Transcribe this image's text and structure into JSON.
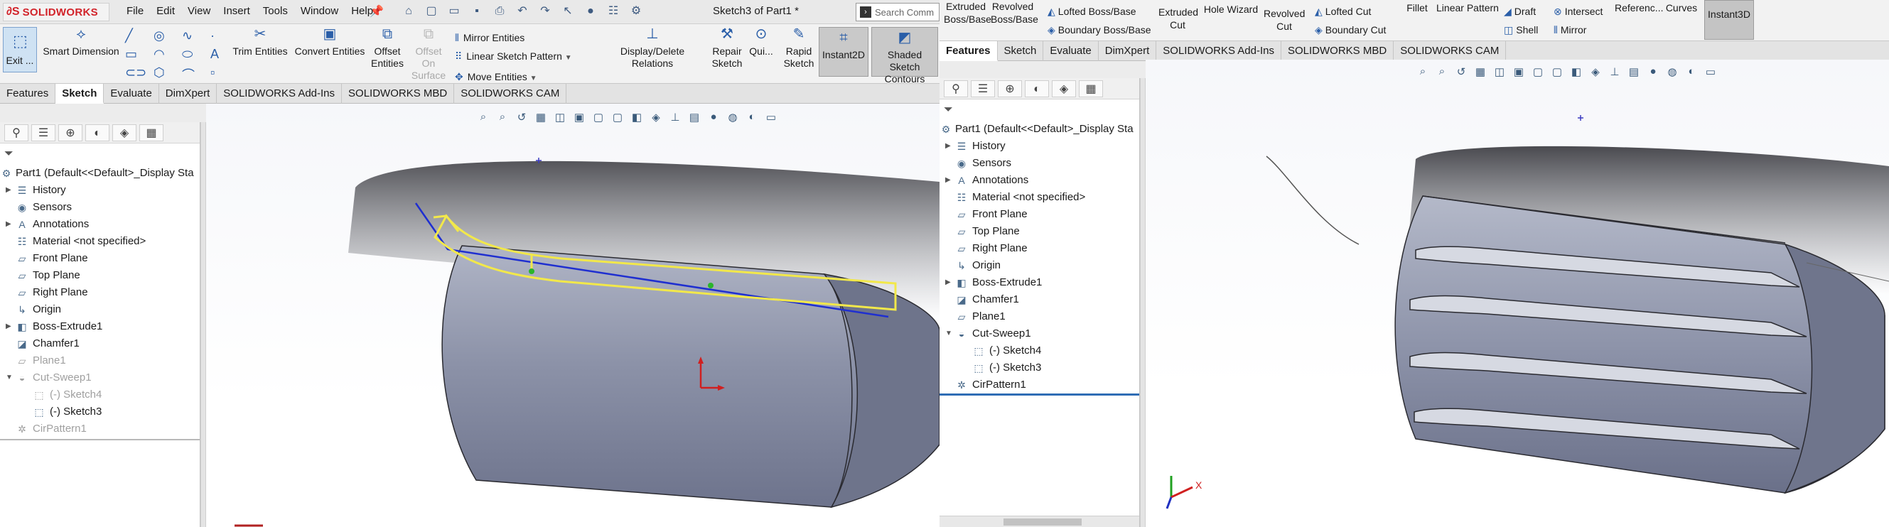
{
  "left": {
    "app": {
      "logo_text": "SOLIDWORKS",
      "title": "Sketch3 of Part1 *",
      "search_placeholder": "Search Comm"
    },
    "menu": [
      "File",
      "Edit",
      "View",
      "Insert",
      "Tools",
      "Window",
      "Help"
    ],
    "commands": {
      "exit": "Exit ...",
      "smart_dimension": "Smart Dimension",
      "trim": "Trim Entities",
      "convert": "Convert Entities",
      "offset": "Offset Entities",
      "offset_surface": "Offset On Surface",
      "mirror": "Mirror Entities",
      "linear_pattern": "Linear Sketch Pattern",
      "move": "Move Entities",
      "display_delete": "Display/Delete Relations",
      "repair": "Repair Sketch",
      "quick": "Qui...",
      "rapid": "Rapid Sketch",
      "instant2d": "Instant2D",
      "shaded": "Shaded Sketch Contours"
    },
    "tabs": [
      "Features",
      "Sketch",
      "Evaluate",
      "DimXpert",
      "SOLIDWORKS Add-Ins",
      "SOLIDWORKS MBD",
      "SOLIDWORKS CAM"
    ],
    "active_tab": "Sketch",
    "tree": [
      {
        "label": "Part1  (Default<<Default>_Display Sta",
        "icon": "part-icon"
      },
      {
        "label": "History",
        "icon": "history-icon"
      },
      {
        "label": "Sensors",
        "icon": "sensor-icon"
      },
      {
        "label": "Annotations",
        "icon": "annotation-icon"
      },
      {
        "label": "Material <not specified>",
        "icon": "material-icon"
      },
      {
        "label": "Front Plane",
        "icon": "plane-icon"
      },
      {
        "label": "Top Plane",
        "icon": "plane-icon"
      },
      {
        "label": "Right Plane",
        "icon": "plane-icon"
      },
      {
        "label": "Origin",
        "icon": "origin-icon"
      },
      {
        "label": "Boss-Extrude1",
        "icon": "extrude-icon"
      },
      {
        "label": "Chamfer1",
        "icon": "chamfer-icon"
      },
      {
        "label": "Plane1",
        "icon": "plane-icon"
      },
      {
        "label": "Cut-Sweep1",
        "icon": "sweep-icon"
      },
      {
        "label": "(-) Sketch4",
        "icon": "sketch-icon"
      },
      {
        "label": "(-) Sketch3",
        "icon": "sketch-icon"
      },
      {
        "label": "CirPattern1",
        "icon": "pattern-icon"
      }
    ]
  },
  "right": {
    "commands": {
      "extruded_boss": "Extruded Boss/Base",
      "revolved_boss": "Revolved Boss/Base",
      "lofted_boss": "Lofted Boss/Base",
      "boundary_boss": "Boundary Boss/Base",
      "extruded_cut": "Extruded Cut",
      "hole_wizard": "Hole Wizard",
      "revolved_cut": "Revolved Cut",
      "lofted_cut": "Lofted Cut",
      "boundary_cut": "Boundary Cut",
      "fillet": "Fillet",
      "linear_pattern": "Linear Pattern",
      "draft": "Draft",
      "shell": "Shell",
      "intersect": "Intersect",
      "mirror": "Mirror",
      "reference": "Referenc...",
      "curves": "Curves",
      "instant3d": "Instant3D"
    },
    "tabs": [
      "Features",
      "Sketch",
      "Evaluate",
      "DimXpert",
      "SOLIDWORKS Add-Ins",
      "SOLIDWORKS MBD",
      "SOLIDWORKS CAM"
    ],
    "active_tab": "Features",
    "tree": [
      {
        "label": "Part1  (Default<<Default>_Display Sta",
        "icon": "part-icon"
      },
      {
        "label": "History",
        "icon": "history-icon"
      },
      {
        "label": "Sensors",
        "icon": "sensor-icon"
      },
      {
        "label": "Annotations",
        "icon": "annotation-icon"
      },
      {
        "label": "Material <not specified>",
        "icon": "material-icon"
      },
      {
        "label": "Front Plane",
        "icon": "plane-icon"
      },
      {
        "label": "Top Plane",
        "icon": "plane-icon"
      },
      {
        "label": "Right Plane",
        "icon": "plane-icon"
      },
      {
        "label": "Origin",
        "icon": "origin-icon"
      },
      {
        "label": "Boss-Extrude1",
        "icon": "extrude-icon"
      },
      {
        "label": "Chamfer1",
        "icon": "chamfer-icon"
      },
      {
        "label": "Plane1",
        "icon": "plane-icon"
      },
      {
        "label": "Cut-Sweep1",
        "icon": "sweep-icon"
      },
      {
        "label": "(-) Sketch4",
        "icon": "sketch-icon"
      },
      {
        "label": "(-) Sketch3",
        "icon": "sketch-icon"
      },
      {
        "label": "CirPattern1",
        "icon": "pattern-icon"
      }
    ],
    "triad_label": "X"
  },
  "colors": {
    "accent": "#2f6db5",
    "model_face": "#8a91a6",
    "model_dark": "#4a5068",
    "sketch_yellow": "#f2e84a",
    "sketch_blue": "#1f2fd0"
  }
}
